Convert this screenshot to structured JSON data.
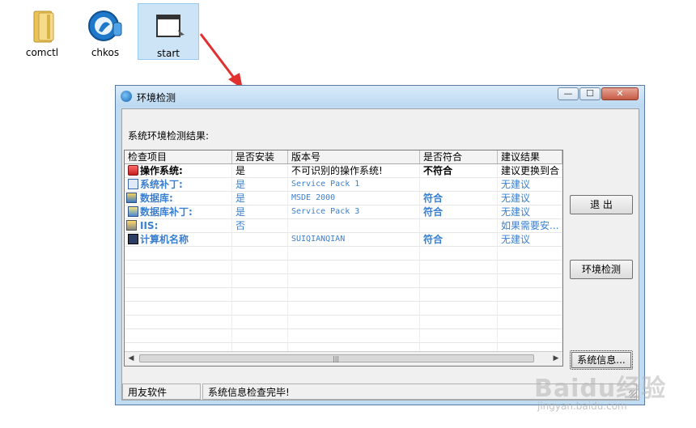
{
  "desktop": {
    "icons": [
      {
        "label": "comctl",
        "icon": "folder-icon"
      },
      {
        "label": "chkos",
        "icon": "chkos-app-icon"
      },
      {
        "label": "start",
        "icon": "start-app-icon",
        "selected": true
      }
    ]
  },
  "window": {
    "title": "环境检测",
    "controls": {
      "min": "—",
      "max": "☐",
      "close": "✕"
    },
    "result_label": "系统环境检测结果:",
    "list": {
      "columns": [
        "检查项目",
        "是否安装",
        "版本号",
        "是否符合",
        "建议结果"
      ],
      "rows": [
        {
          "item": "操作系统:",
          "installed": "是",
          "version": "不可识别的操作系统!",
          "match": "不符合",
          "advice": "建议更换到合",
          "icon": "warning-computer-icon",
          "color": "#000000",
          "bold": true,
          "indent": false
        },
        {
          "item": "系统补丁:",
          "installed": "是",
          "version": "Service Pack 1",
          "match": "",
          "advice": "无建议",
          "icon": "calculator-icon",
          "color": "#3a7fd0",
          "bold": true,
          "indent": false
        },
        {
          "item": "数据库:",
          "installed": "是",
          "version": "MSDE 2000",
          "match": "符合",
          "advice": "无建议",
          "icon": "database-icon",
          "color": "#3a7fd0",
          "bold": true,
          "indent": true
        },
        {
          "item": "数据库补丁:",
          "installed": "是",
          "version": "Service Pack 3",
          "match": "符合",
          "advice": "无建议",
          "icon": "database-patch-icon",
          "color": "#3a7fd0",
          "bold": true,
          "indent": false
        },
        {
          "item": "IIS:",
          "installed": "否",
          "version": "",
          "match": "",
          "advice": "如果需要安...",
          "icon": "iis-icon",
          "color": "#3a7fd0",
          "bold": true,
          "indent": true
        },
        {
          "item": "计算机名称",
          "installed": "",
          "version": "SUIQIANQIAN",
          "match": "符合",
          "advice": "无建议",
          "icon": "monitor-icon",
          "color": "#3a7fd0",
          "bold": true,
          "indent": false
        }
      ],
      "scroll": {
        "left": "◀",
        "right": "▶",
        "grip": "|||"
      }
    },
    "buttons": {
      "exit": "退 出",
      "check": "环境检测",
      "sysinfo": "系统信息..."
    },
    "status": {
      "left": "用友软件",
      "right": "系统信息检查完毕!"
    }
  },
  "watermark": {
    "logo": "Baidu经验",
    "url": "jingyan.baidu.com"
  },
  "colors": {
    "accent_blue": "#3a7fd0",
    "arrow": "#e03030",
    "titlebar": "#c0dcf3"
  }
}
